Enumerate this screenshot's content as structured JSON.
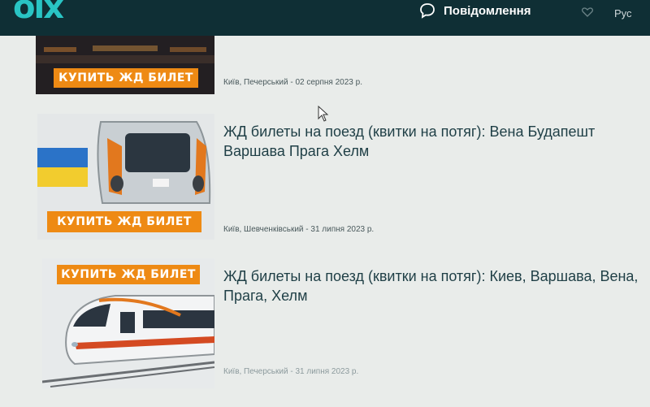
{
  "header": {
    "logo": "olx",
    "messages_label": "Повідомлення",
    "language": "Рус"
  },
  "listings": [
    {
      "banner": "КУПИТЬ ЖД БИЛЕТ",
      "title": "",
      "meta": "Київ, Печерський - 02 серпня 2023 р."
    },
    {
      "banner": "КУПИТЬ ЖД БИЛЕТ",
      "title": "ЖД билеты на поезд (квитки на потяг): Вена Будапешт Варшава Прага Хелм",
      "meta": "Київ, Шевченківський - 31 липня 2023 р."
    },
    {
      "banner": "КУПИТЬ ЖД БИЛЕТ",
      "title": "ЖД билеты на поезд (квитки на потяг): Киев, Варшава, Вена, Прага, Хелм",
      "meta": "Київ, Печерський - 31 липня 2023 р."
    }
  ],
  "colors": {
    "header_bg": "#0f2f35",
    "logo": "#29c4c4",
    "banner": "#ee8a14",
    "page_bg": "#e9ecea",
    "title_text": "#1f3f46"
  }
}
